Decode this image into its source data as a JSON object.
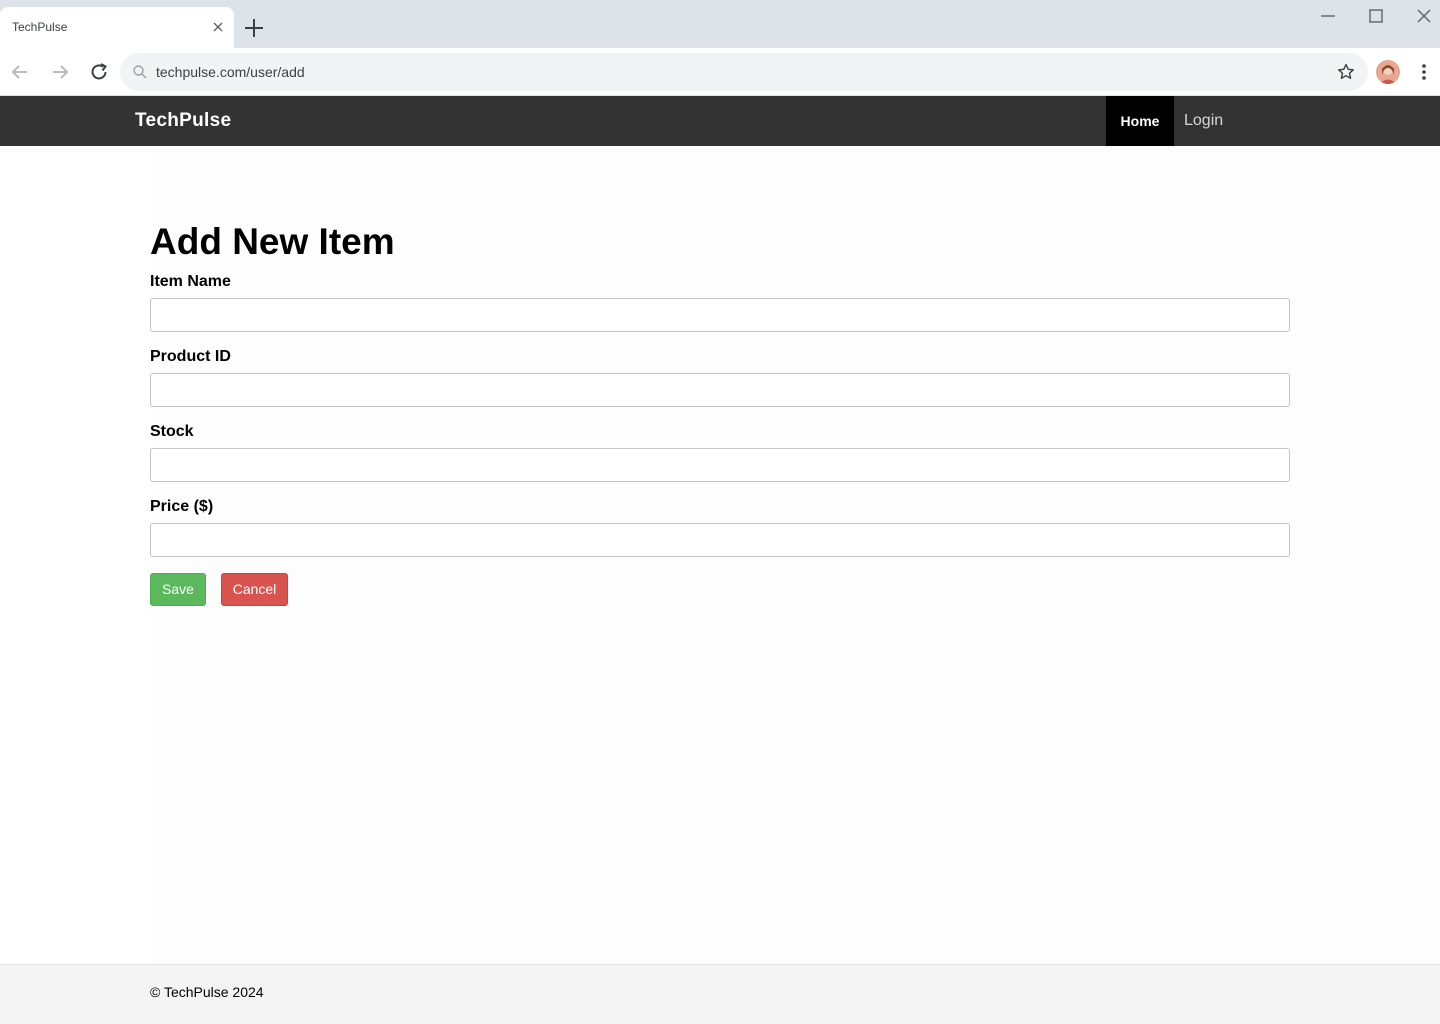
{
  "browser": {
    "tab_title": "TechPulse",
    "url": "techpulse.com/user/add"
  },
  "site": {
    "brand": "TechPulse",
    "nav": {
      "home": "Home",
      "login": "Login"
    }
  },
  "form": {
    "title": "Add New Item",
    "fields": [
      {
        "label": "Item Name",
        "value": ""
      },
      {
        "label": "Product ID",
        "value": ""
      },
      {
        "label": "Stock",
        "value": ""
      },
      {
        "label": "Price ($)",
        "value": ""
      }
    ],
    "save_label": "Save",
    "cancel_label": "Cancel"
  },
  "footer": {
    "text": "© TechPulse 2024"
  },
  "colors": {
    "header_bg": "#333333",
    "nav_active_bg": "#000000",
    "save_green": "#5cb85c",
    "cancel_red": "#d9534f"
  },
  "icons": [
    "close-icon",
    "plus-icon",
    "minimize-icon",
    "maximize-icon",
    "back-icon",
    "forward-icon",
    "reload-icon",
    "search-icon",
    "star-icon",
    "more-icon"
  ]
}
